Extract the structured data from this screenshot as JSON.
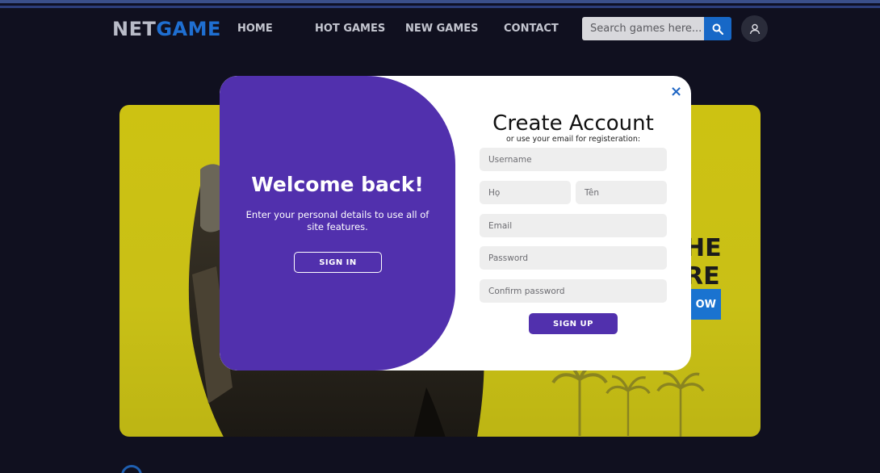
{
  "nav": {
    "logo_net": "NET",
    "logo_game": "GAME",
    "links": [
      "HOME",
      "HOT GAMES",
      "NEW GAMES",
      "CONTACT"
    ],
    "search_placeholder": "Search games here...",
    "search_icon": "search-icon",
    "user_icon": "user-icon"
  },
  "banner": {
    "line1_partial": "HE",
    "line2_partial": "RE",
    "button_partial": "OW"
  },
  "modal": {
    "close_icon": "×",
    "left": {
      "title": "Welcome back!",
      "subtitle": "Enter your personal details to use all of site features.",
      "signin_label": "SIGN IN"
    },
    "right": {
      "title": "Create Account",
      "subtitle": "or use your email for registeration:",
      "fields": {
        "username": "Username",
        "first": "Họ",
        "last": "Tên",
        "email": "Email",
        "password": "Password",
        "confirm": "Confirm password"
      },
      "signup_label": "SIGN UP"
    }
  },
  "colors": {
    "accent_purple": "#5130ad",
    "brand_blue": "#1f6fd1",
    "banner_yellow": "#cdc212",
    "background": "#10101f"
  }
}
